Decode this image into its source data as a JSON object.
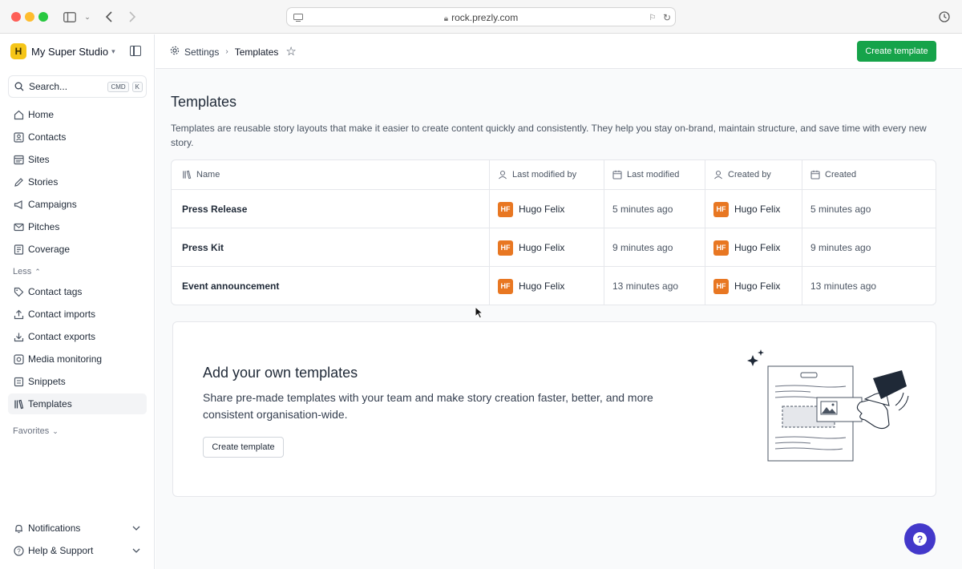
{
  "browser": {
    "url": "rock.prezly.com"
  },
  "sidebar": {
    "workspace_initial": "H",
    "workspace_name": "My Super Studio",
    "search_label": "Search...",
    "search_kbd_1": "CMD",
    "search_kbd_2": "K",
    "items": [
      {
        "label": "Home",
        "icon": "home-icon"
      },
      {
        "label": "Contacts",
        "icon": "contacts-icon"
      },
      {
        "label": "Sites",
        "icon": "sites-icon"
      },
      {
        "label": "Stories",
        "icon": "pen-icon"
      },
      {
        "label": "Campaigns",
        "icon": "megaphone-icon"
      },
      {
        "label": "Pitches",
        "icon": "envelope-icon"
      },
      {
        "label": "Coverage",
        "icon": "coverage-icon"
      }
    ],
    "less_label": "Less",
    "more_items": [
      {
        "label": "Contact tags",
        "icon": "tag-icon"
      },
      {
        "label": "Contact imports",
        "icon": "upload-icon"
      },
      {
        "label": "Contact exports",
        "icon": "download-icon"
      },
      {
        "label": "Media monitoring",
        "icon": "monitor-icon"
      },
      {
        "label": "Snippets",
        "icon": "snippet-icon"
      },
      {
        "label": "Templates",
        "icon": "templates-icon"
      }
    ],
    "favorites_label": "Favorites",
    "notifications_label": "Notifications",
    "help_label": "Help & Support"
  },
  "topbar": {
    "breadcrumb_settings": "Settings",
    "breadcrumb_current": "Templates",
    "create_button": "Create template"
  },
  "page": {
    "title": "Templates",
    "description": "Templates are reusable story layouts that make it easier to create content quickly and consistently. They help you stay on-brand, maintain structure, and save time with every new story."
  },
  "table": {
    "columns": [
      "Name",
      "Last modified by",
      "Last modified",
      "Created by",
      "Created"
    ],
    "rows": [
      {
        "name": "Press Release",
        "modified_by": "Hugo Felix",
        "modified_initials": "HF",
        "modified": "5 minutes ago",
        "created_by": "Hugo Felix",
        "created_initials": "HF",
        "created": "5 minutes ago"
      },
      {
        "name": "Press Kit",
        "modified_by": "Hugo Felix",
        "modified_initials": "HF",
        "modified": "9 minutes ago",
        "created_by": "Hugo Felix",
        "created_initials": "HF",
        "created": "9 minutes ago"
      },
      {
        "name": "Event announcement",
        "modified_by": "Hugo Felix",
        "modified_initials": "HF",
        "modified": "13 minutes ago",
        "created_by": "Hugo Felix",
        "created_initials": "HF",
        "created": "13 minutes ago"
      }
    ]
  },
  "promo": {
    "title": "Add your own templates",
    "text": "Share pre-made templates with your team and make story creation faster, better, and more consistent organisation-wide.",
    "button": "Create template"
  },
  "colors": {
    "primary": "#16a34a",
    "avatar": "#e87722",
    "help": "#4338ca",
    "workspace": "#f5c518"
  }
}
